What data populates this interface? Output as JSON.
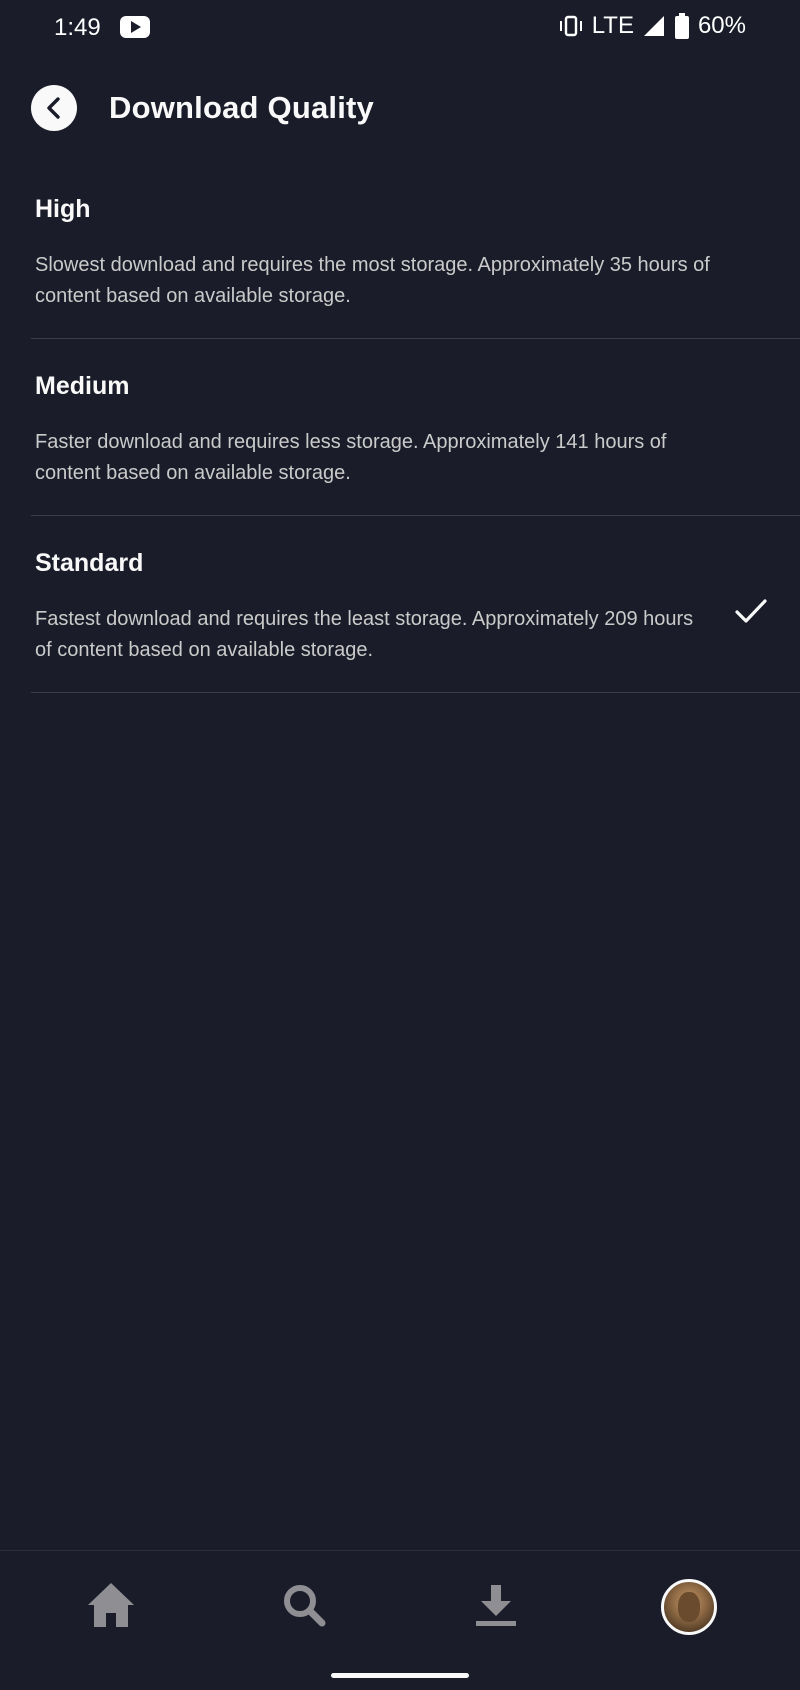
{
  "status_bar": {
    "time": "1:49",
    "network": "LTE",
    "battery": "60%",
    "icons": [
      "youtube-icon",
      "vibrate-icon",
      "signal-icon",
      "battery-icon"
    ]
  },
  "header": {
    "title": "Download Quality",
    "back_icon": "chevron-left-icon"
  },
  "options": [
    {
      "title": "High",
      "description": "Slowest download and requires the most storage. Approximately 35 hours of content based on available storage.",
      "selected": false
    },
    {
      "title": "Medium",
      "description": "Faster download and requires less storage. Approximately 141 hours of content based on available storage.",
      "selected": false
    },
    {
      "title": "Standard",
      "description": "Fastest download and requires the least storage. Approximately 209 hours of content based on available storage.",
      "selected": true
    }
  ],
  "bottom_nav": {
    "items": [
      "home-icon",
      "search-icon",
      "downloads-icon",
      "profile-avatar"
    ]
  },
  "colors": {
    "background": "#1a1d29",
    "text": "#f9f9f9",
    "secondary_text": "#cacaca",
    "nav_icon": "#8e8e93"
  }
}
